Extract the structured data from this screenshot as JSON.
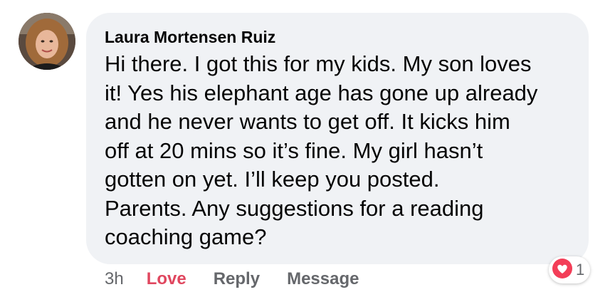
{
  "comment": {
    "author": "Laura Mortensen Ruiz",
    "text": "Hi there. I got this for my kids. My son loves\nit! Yes his elephant age has gone up already\nand he never wants to get off. It kicks him\noff at 20 mins so it’s fine. My girl hasn’t\ngotten on yet. I’ll keep you posted.\nParents. Any suggestions for a reading\ncoaching game?"
  },
  "actions": {
    "timestamp": "3h",
    "love_label": "Love",
    "reply_label": "Reply",
    "message_label": "Message"
  },
  "reaction": {
    "icon": "heart-icon",
    "count": "1",
    "color": "#f33e58"
  },
  "colors": {
    "bubble": "#f0f2f5",
    "text": "#050505",
    "secondary": "#65676b",
    "love_active": "#e0475f"
  }
}
